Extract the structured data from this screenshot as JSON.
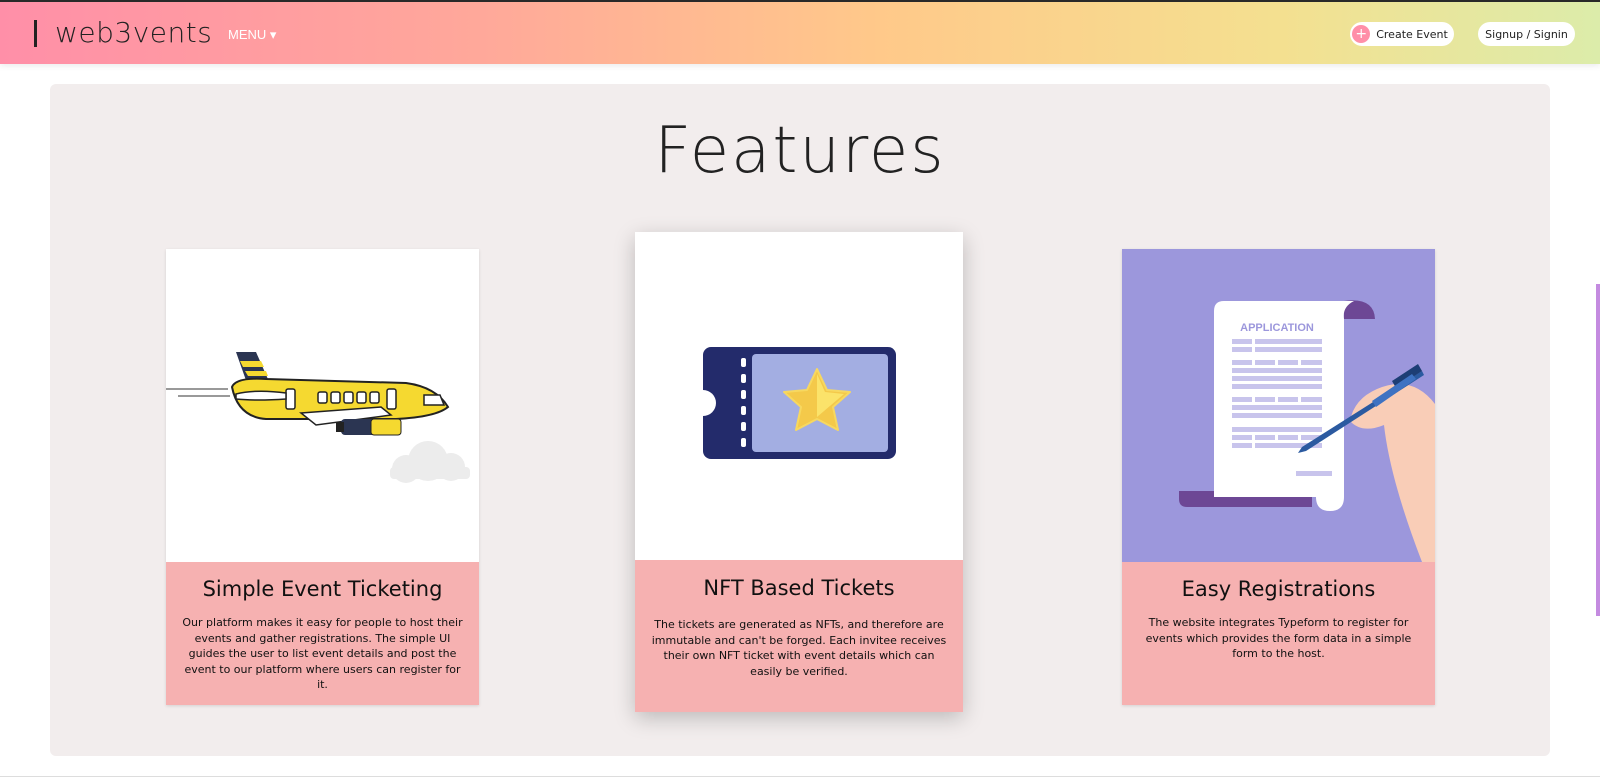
{
  "header": {
    "logo": "web3vents",
    "menu_label": "MENU ▾",
    "create_event_label": "Create Event",
    "signin_label": "Signup / Signin"
  },
  "features": {
    "title": "Features",
    "cards": [
      {
        "title": "Simple Event Ticketing",
        "description": "Our platform makes it easy for people to host their events and gather registrations. The simple UI guides the user to list event details and post the event to our platform where users can register for it.",
        "icon": "airplane-illustration"
      },
      {
        "title": "NFT Based Tickets",
        "description": "The tickets are generated as NFTs, and therefore are immutable and can't be forged. Each invitee receives their own NFT ticket with event details which can easily be verified.",
        "icon": "ticket-star-illustration"
      },
      {
        "title": "Easy Registrations",
        "description": "The website integrates Typeform to register for events which provides the form data in a simple form to the host.",
        "icon": "application-form-illustration",
        "form_heading": "APPLICATION"
      }
    ]
  },
  "colors": {
    "card_footer": "#f6b1b1",
    "section_bg": "#f2eded",
    "accent_pink": "#ff8fa8"
  }
}
